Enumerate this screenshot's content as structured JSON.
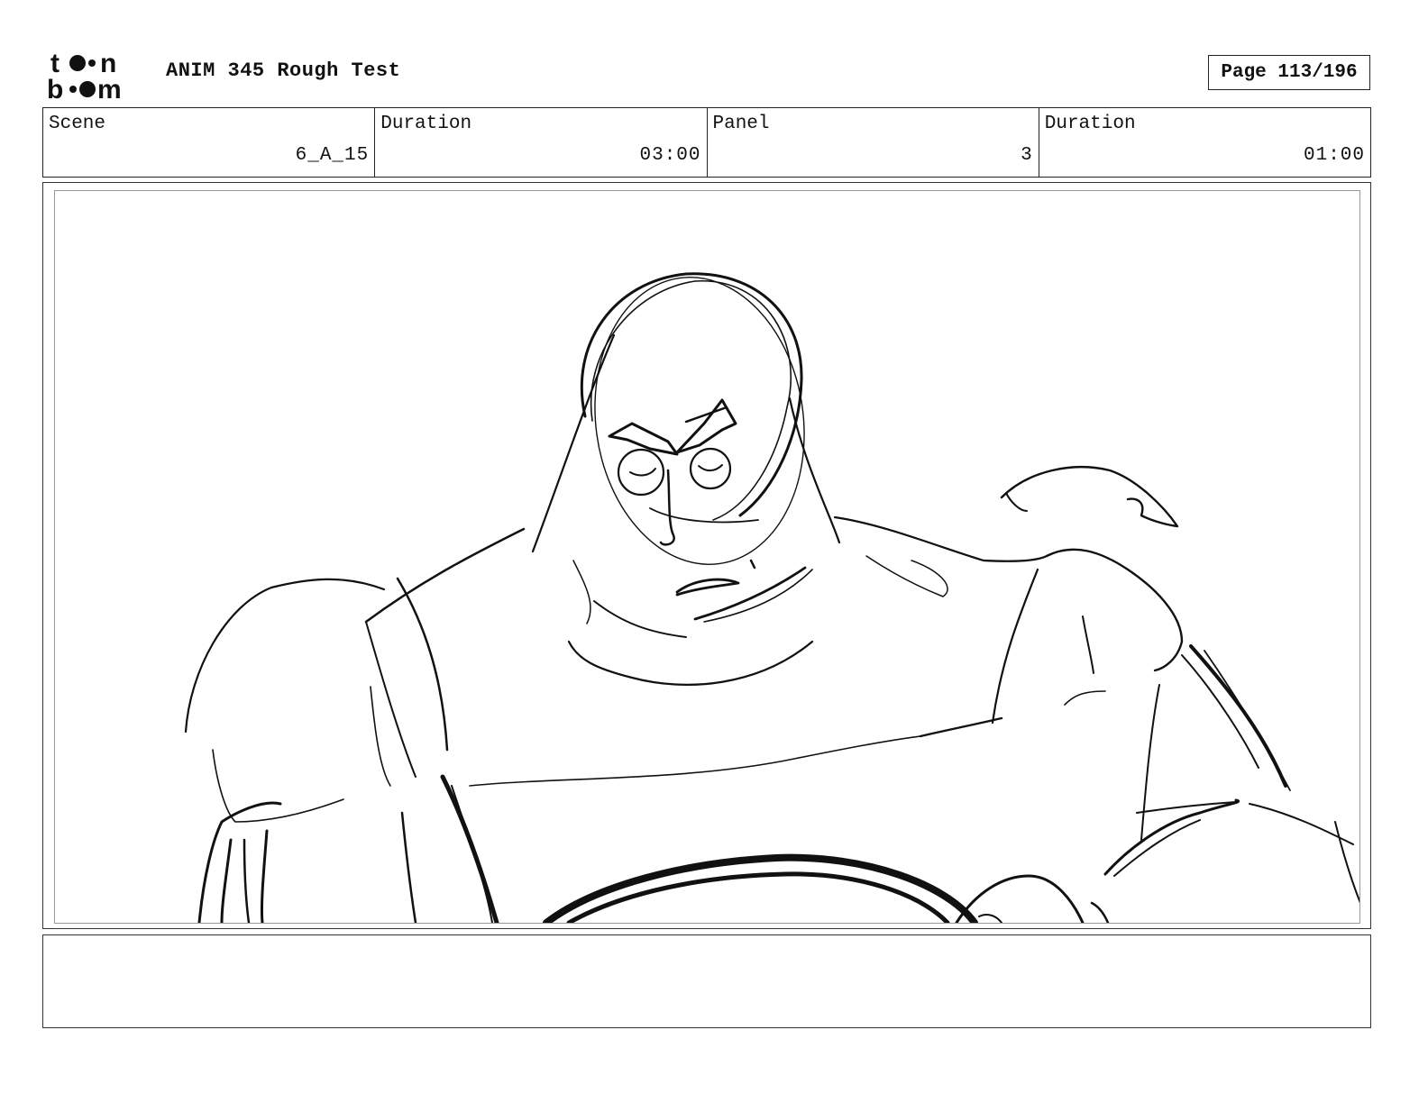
{
  "header": {
    "logo_text": "toon boom",
    "title": "ANIM 345 Rough Test",
    "page_indicator": "Page 113/196"
  },
  "info_table": [
    {
      "label": "Scene",
      "value": "6_A_15"
    },
    {
      "label": "Duration",
      "value": "03:00"
    },
    {
      "label": "Panel",
      "value": "3"
    },
    {
      "label": "Duration",
      "value": "01:00"
    }
  ],
  "notes": {
    "text": ""
  }
}
